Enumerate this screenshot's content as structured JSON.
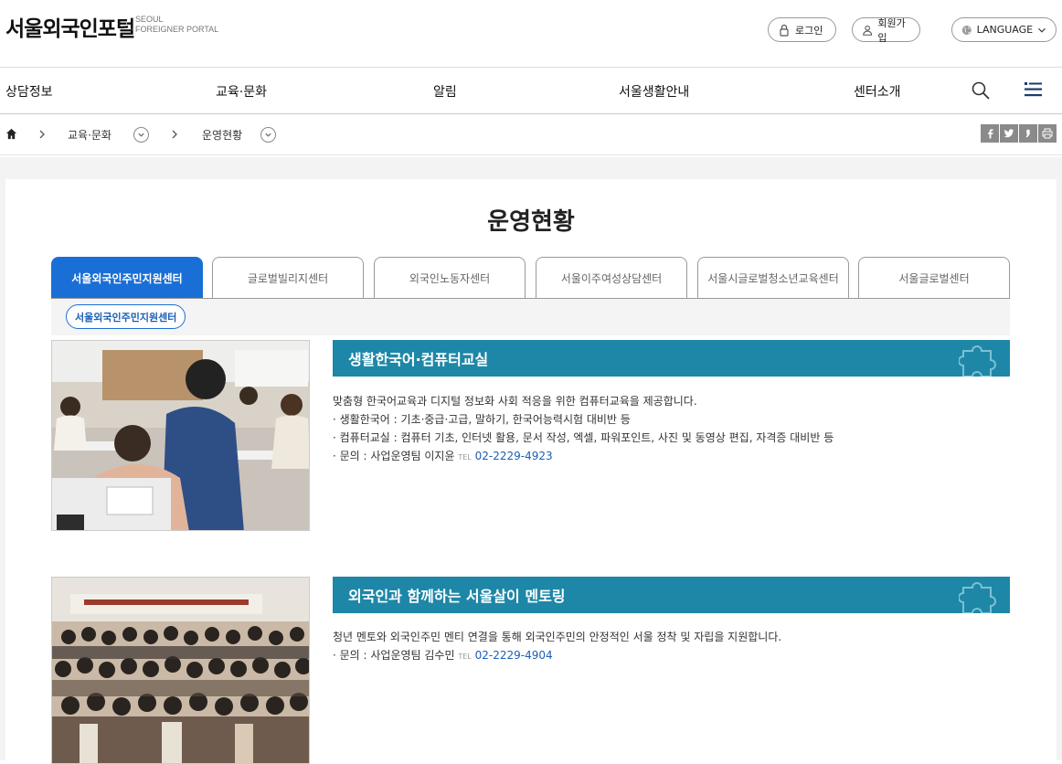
{
  "header": {
    "logo_ko": "서울외국인포털",
    "logo_en_line1": "SEOUL",
    "logo_en_line2": "FOREIGNER PORTAL",
    "login": "로그인",
    "signup": "회원가입",
    "language": "LANGUAGE"
  },
  "gnb": [
    "상담정보",
    "교육·문화",
    "알림",
    "서울생활안내",
    "센터소개"
  ],
  "breadcrumb": {
    "level1": "교육·문화",
    "level2": "운영현황"
  },
  "page_title": "운영현황",
  "tabs": [
    {
      "label": "서울외국인주민지원센터",
      "active": true
    },
    {
      "label": "글로벌빌리지센터",
      "active": false
    },
    {
      "label": "외국인노동자센터",
      "active": false
    },
    {
      "label": "서울이주여성상담센터",
      "active": false
    },
    {
      "label": "서울시글로벌청소년교육센터",
      "active": false
    },
    {
      "label": "서울글로벌센터",
      "active": false
    }
  ],
  "sub_tab": "서울외국인주민지원센터",
  "programs": [
    {
      "title": "생활한국어·컴퓨터교실",
      "intro": "맞춤형 한국어교육과 디지털 정보화 사회 적응을 위한 컴퓨터교육을 제공합니다.",
      "bullets": [
        "· 생활한국어 : 기초·중급·고급, 말하기, 한국어능력시험 대비반 등",
        "· 컴퓨터교실 : 컴퓨터 기초, 인터넷 활용, 문서 작성, 엑셀, 파워포인트, 사진 및 동영상 편집, 자격증 대비반 등"
      ],
      "contact_label": "· 문의 : 사업운영팀 이지윤",
      "tel_mark": "TEL",
      "phone": "02-2229-4923"
    },
    {
      "title": "외국인과 함께하는 서울살이 멘토링",
      "intro": "청년 멘토와 외국인주민 멘티 연결을 통해 외국인주민의 안정적인 서울 정착 및 자립을 지원합니다.",
      "bullets": [],
      "contact_label": "· 문의 : 사업운영팀 김수민",
      "tel_mark": "TEL",
      "phone": "02-2229-4904"
    }
  ],
  "colors": {
    "tab_active": "#1a6fd6",
    "program_title_bg": "#1e87a7",
    "phone_link": "#1a5fb4"
  }
}
